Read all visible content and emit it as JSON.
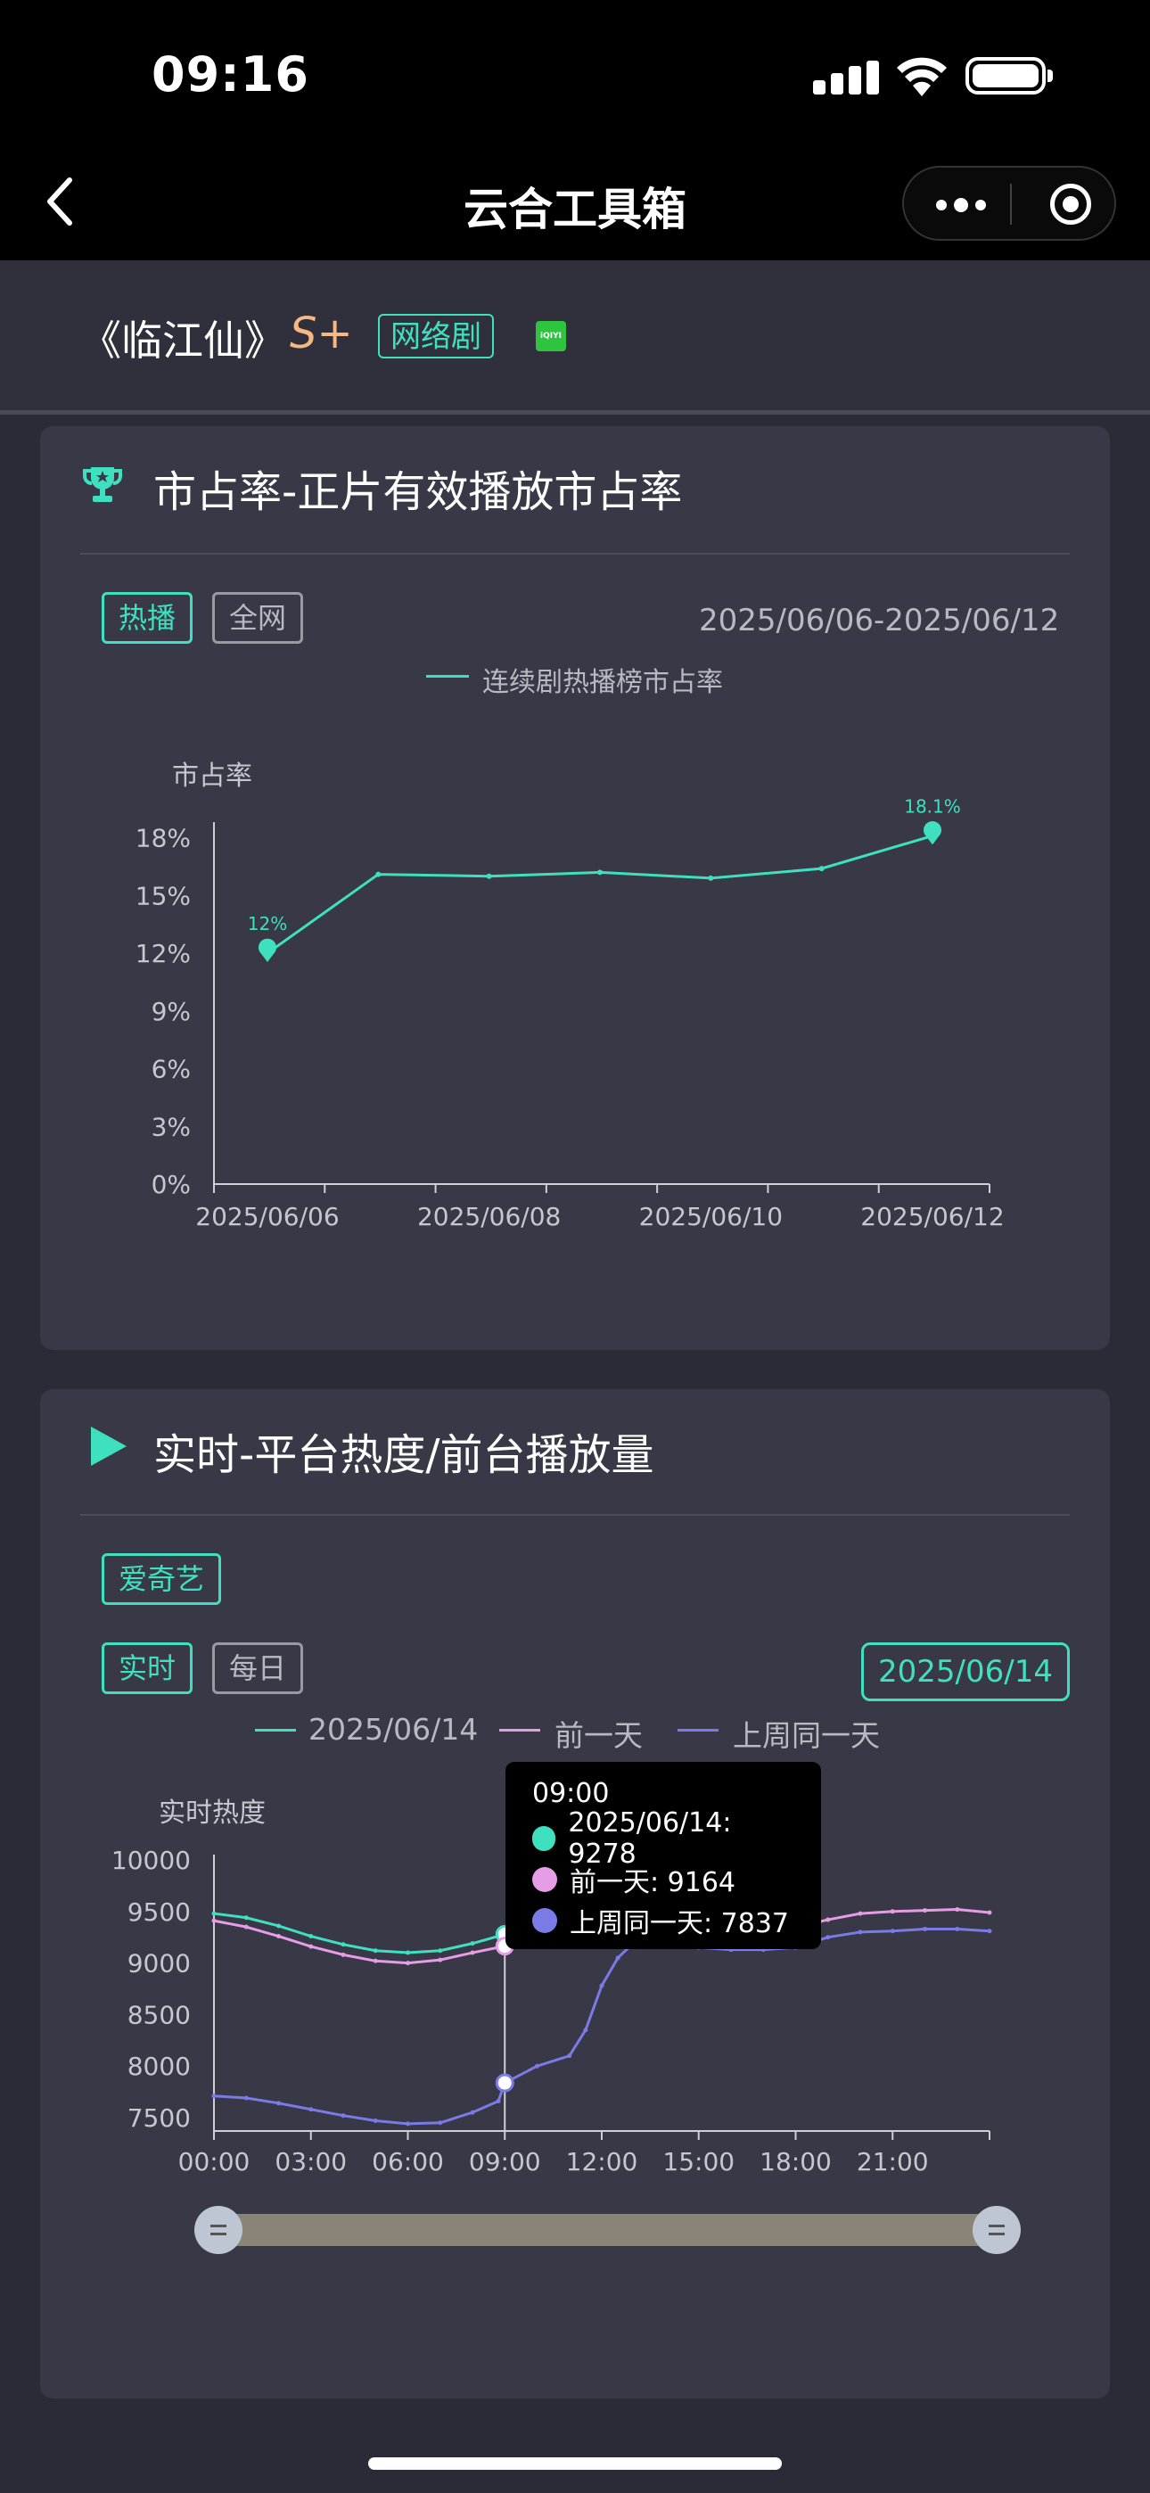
{
  "status": {
    "time": "09:16"
  },
  "nav": {
    "title": "云合工具箱"
  },
  "header": {
    "drama": "《临江仙》",
    "rank": "S+",
    "type": "网络剧",
    "platform_logo_text": "iQIYI"
  },
  "card1": {
    "title": "市占率-正片有效播放市占率",
    "tags": [
      "热播",
      "全网"
    ],
    "date_range": "2025/06/06-2025/06/12",
    "legend": "连续剧热播榜市占率"
  },
  "card2": {
    "title": "实时-平台热度/前台播放量",
    "platform_tag": "爱奇艺",
    "mode_tags": [
      "实时",
      "每日"
    ],
    "date": "2025/06/14",
    "legend": [
      "2025/06/14",
      "前一天",
      "上周同一天"
    ]
  },
  "tooltip": {
    "time": "09:00",
    "rows": [
      {
        "label": "2025/06/14: 9278",
        "color": "#3fe0c0"
      },
      {
        "label": "前一天: 9164",
        "color": "#e59de6"
      },
      {
        "label": "上周同一天: 7837",
        "color": "#7b7be8"
      }
    ]
  },
  "colors": {
    "accent": "#3fe0c0",
    "prev_day": "#e59de6",
    "last_week": "#7b7be8",
    "background": "#2b2b37",
    "card": "#383846"
  },
  "chart_data": [
    {
      "type": "line",
      "title": "",
      "ylabel": "市占率",
      "xlabel": "",
      "y_unit": "%",
      "x": [
        "2025/06/06",
        "2025/06/07",
        "2025/06/08",
        "2025/06/09",
        "2025/06/10",
        "2025/06/11",
        "2025/06/12"
      ],
      "x_tick_labels": [
        "2025/06/06",
        "2025/06/08",
        "2025/06/10",
        "2025/06/12"
      ],
      "y_ticks": [
        "0%",
        "3%",
        "6%",
        "9%",
        "12%",
        "15%",
        "18%"
      ],
      "ylim": [
        0,
        19
      ],
      "series": [
        {
          "name": "连续剧热播榜市占率",
          "color": "#3fe0c0",
          "values": [
            12,
            16.1,
            16.0,
            16.2,
            15.9,
            16.4,
            18.1
          ]
        }
      ],
      "annotations": [
        {
          "x": "2025/06/06",
          "label": "12%"
        },
        {
          "x": "2025/06/12",
          "label": "18.1%"
        }
      ],
      "grid": false
    },
    {
      "type": "line",
      "title": "",
      "ylabel": "实时热度",
      "xlabel": "",
      "x_tick_labels": [
        "00:00",
        "03:00",
        "06:00",
        "09:00",
        "12:00",
        "15:00",
        "18:00",
        "21:00"
      ],
      "y_ticks": [
        "7500",
        "8000",
        "8500",
        "9000",
        "9500",
        "10000"
      ],
      "ylim": [
        7400,
        10000
      ],
      "x_unit_hours": [
        0,
        24
      ],
      "grid": false,
      "series": [
        {
          "name": "2025/06/14",
          "color": "#3fe0c0",
          "points": [
            [
              0,
              9480
            ],
            [
              1,
              9440
            ],
            [
              2,
              9360
            ],
            [
              3,
              9260
            ],
            [
              4,
              9180
            ],
            [
              5,
              9120
            ],
            [
              6,
              9100
            ],
            [
              7,
              9120
            ],
            [
              8,
              9190
            ],
            [
              9,
              9278
            ]
          ]
        },
        {
          "name": "前一天",
          "color": "#e59de6",
          "points": [
            [
              0,
              9410
            ],
            [
              1,
              9350
            ],
            [
              2,
              9260
            ],
            [
              3,
              9160
            ],
            [
              4,
              9080
            ],
            [
              5,
              9020
            ],
            [
              6,
              9000
            ],
            [
              7,
              9030
            ],
            [
              8,
              9100
            ],
            [
              9,
              9164
            ],
            [
              10,
              9230
            ],
            [
              11,
              9290
            ],
            [
              12,
              9330
            ],
            [
              13,
              9340
            ],
            [
              14,
              9320
            ],
            [
              15,
              9300
            ],
            [
              16,
              9290
            ],
            [
              17,
              9300
            ],
            [
              18,
              9350
            ],
            [
              19,
              9420
            ],
            [
              20,
              9480
            ],
            [
              21,
              9500
            ],
            [
              22,
              9510
            ],
            [
              23,
              9520
            ],
            [
              24,
              9490
            ]
          ]
        },
        {
          "name": "上周同一天",
          "color": "#7b7be8",
          "points": [
            [
              0,
              7710
            ],
            [
              1,
              7690
            ],
            [
              2,
              7640
            ],
            [
              3,
              7580
            ],
            [
              4,
              7520
            ],
            [
              5,
              7470
            ],
            [
              6,
              7440
            ],
            [
              7,
              7450
            ],
            [
              8,
              7550
            ],
            [
              8.8,
              7660
            ],
            [
              9,
              7837
            ],
            [
              10,
              8000
            ],
            [
              11,
              8100
            ],
            [
              11.5,
              8350
            ],
            [
              12,
              8780
            ],
            [
              12.5,
              9050
            ],
            [
              13,
              9200
            ],
            [
              14,
              9220
            ],
            [
              15,
              9150
            ],
            [
              16,
              9130
            ],
            [
              17,
              9130
            ],
            [
              18,
              9150
            ],
            [
              19,
              9250
            ],
            [
              20,
              9300
            ],
            [
              21,
              9310
            ],
            [
              22,
              9330
            ],
            [
              23,
              9330
            ],
            [
              24,
              9310
            ]
          ]
        }
      ],
      "cursor_x": 9
    }
  ]
}
